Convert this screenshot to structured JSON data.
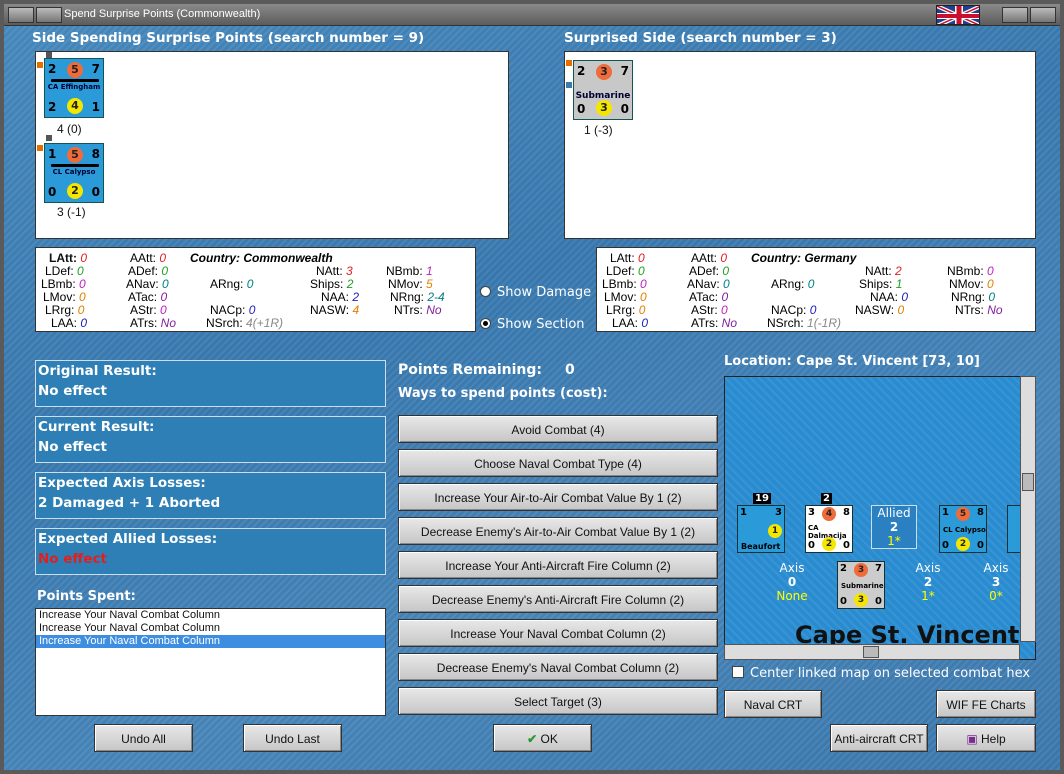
{
  "window": {
    "title": "Spend Surprise Points (Commonwealth)"
  },
  "left": {
    "header": "Side Spending Surprise Points (search number = 9)",
    "units": [
      {
        "name": "CA Effingham",
        "tl": "2",
        "tc": "5",
        "tr": "7",
        "bl": "2",
        "bc": "4",
        "br": "1",
        "label": "4 (0)"
      },
      {
        "name": "CL Calypso",
        "tl": "1",
        "tc": "5",
        "tr": "8",
        "bl": "0",
        "bc": "2",
        "br": "0",
        "label": "3 (-1)"
      }
    ]
  },
  "right": {
    "header": "Surprised Side (search number = 3)",
    "units": [
      {
        "name": "Submarine",
        "tl": "2",
        "tc": "3",
        "tr": "7",
        "bl": "0",
        "bc": "3",
        "br": "0",
        "label": "1 (-3)"
      }
    ]
  },
  "stats_left": {
    "country_label": "Country:",
    "country": "Commonwealth",
    "rows": {
      "LAtt": "0",
      "LDef": "0",
      "LBmb": "0",
      "LMov": "0",
      "LRrg": "0",
      "LAA": "0",
      "AAtt": "0",
      "ADef": "0",
      "ANav": "0",
      "ATac": "0",
      "AStr": "0",
      "ATrs": "No",
      "ARng": "0",
      "NACp": "0",
      "NSrch": "4(+1R)",
      "NAtt": "3",
      "Ships": "2",
      "NAA": "2",
      "NASW": "4",
      "NBmb": "1",
      "NMov": "5",
      "NRng": "2-4",
      "NTrs": "No"
    }
  },
  "stats_right": {
    "country_label": "Country:",
    "country": "Germany",
    "rows": {
      "LAtt": "0",
      "LDef": "0",
      "LBmb": "0",
      "LMov": "0",
      "LRrg": "0",
      "LAA": "0",
      "AAtt": "0",
      "ADef": "0",
      "ANav": "0",
      "ATac": "0",
      "AStr": "0",
      "ATrs": "No",
      "ARng": "0",
      "NACp": "0",
      "NSrch": "1(-1R)",
      "NAtt": "2",
      "Ships": "1",
      "NAA": "0",
      "NASW": "0",
      "NBmb": "0",
      "NMov": "0",
      "NRng": "0",
      "NTrs": "No"
    }
  },
  "radios": {
    "show_damage": "Show Damage",
    "show_section": "Show Section"
  },
  "results": [
    {
      "title": "Original Result:",
      "value": "No effect"
    },
    {
      "title": "Current Result:",
      "value": "No effect"
    },
    {
      "title": "Expected Axis Losses:",
      "value": "2 Damaged + 1 Aborted"
    },
    {
      "title": "Expected Allied Losses:",
      "value": "No effect"
    }
  ],
  "points_spent": {
    "title": "Points Spent:",
    "items": [
      "Increase Your Naval Combat Column",
      "Increase Your Naval Combat Column",
      "Increase Your Naval Combat Column"
    ]
  },
  "spend": {
    "remaining_label": "Points Remaining:",
    "remaining": "0",
    "ways_label": "Ways to spend points (cost):",
    "options": [
      "Avoid Combat (4)",
      "Choose Naval Combat Type (4)",
      "Increase Your Air-to-Air Combat Value By 1 (2)",
      "Decrease Enemy's Air-to-Air Combat Value By 1 (2)",
      "Increase Your Anti-Aircraft Fire Column (2)",
      "Decrease Enemy's Anti-Aircraft Fire Column (2)",
      "Increase Your Naval Combat Column (2)",
      "Decrease Enemy's Naval Combat Column (2)",
      "Select Target (3)"
    ]
  },
  "map": {
    "location": "Location: Cape St. Vincent [73, 10]",
    "map_name": "Cape St. Vincent",
    "boxes": [
      {
        "side": "Allied",
        "num": "2",
        "sub": "1*"
      },
      {
        "side": "Axis",
        "num": "0",
        "sub": "None"
      },
      {
        "side": "Axis",
        "num": "2",
        "sub": "1*"
      },
      {
        "side": "Axis",
        "num": "3",
        "sub": "0*"
      }
    ],
    "stack_counts": [
      "19",
      "2"
    ],
    "unit_names": [
      "Beaufort",
      "CA Dalmacija",
      "CL Calypso",
      "Submarine"
    ],
    "center_checkbox": "Center linked map on selected combat hex"
  },
  "buttons": {
    "naval_crt": "Naval CRT",
    "wif_charts": "WIF FE Charts",
    "aa_crt": "Anti-aircraft CRT",
    "help": "Help",
    "undo_all": "Undo All",
    "undo_last": "Undo Last",
    "ok": "OK"
  },
  "colors": {
    "accent_red": "#e02020",
    "panel_blue": "#2e7fb5"
  }
}
